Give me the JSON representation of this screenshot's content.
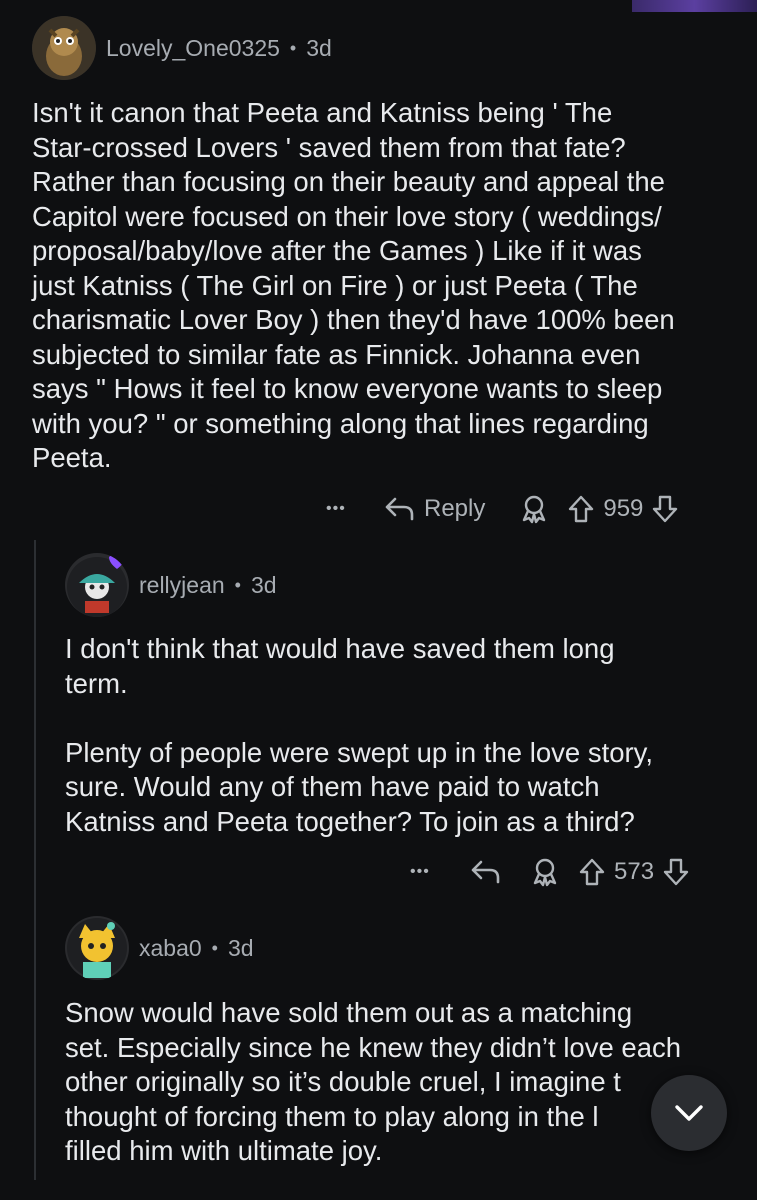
{
  "colors": {
    "background": "#0e0f11",
    "text": "#e8eaed",
    "meta": "#a7acb2",
    "accent_heart": "#8a4fff"
  },
  "comments": [
    {
      "username": "Lovely_One0325",
      "separator": "•",
      "time": "3d",
      "body": "Isn't it canon that Peeta and Katniss being ' The\nStar-crossed Lovers ' saved them from that fate?\nRather than focusing on their beauty and appeal the\nCapitol were focused on their love story ( weddings/\nproposal/baby/love after the Games ) Like if it was\njust Katniss ( The Girl on Fire ) or just Peeta ( The\ncharismatic Lover Boy ) then they'd have 100% been\nsubjected to similar fate as Finnick. Johanna even\nsays \" Hows it feel to know everyone wants to sleep\nwith you? \" or something along that lines regarding\nPeeta.",
      "more_label": "•••",
      "reply_label": "Reply",
      "score": "959"
    },
    {
      "username": "rellyjean",
      "separator": "•",
      "time": "3d",
      "body": "I don't think that would have saved them long\nterm.\n\nPlenty of people were swept up in the love story,\nsure. Would any of them have paid to watch\nKatniss and Peeta together? To join as a third?",
      "more_label": "•••",
      "score": "573"
    },
    {
      "username": "xaba0",
      "separator": "•",
      "time": "3d",
      "body": "Snow would have sold them out as a matching\nset. Especially since he knew they didn’t love each\nother originally so it’s double cruel, I imagine t\nthought of forcing them to play along in the l\nfilled him with ultimate joy."
    }
  ],
  "icons": [
    "more-icon",
    "reply-icon",
    "award-icon",
    "upvote-icon",
    "downvote-icon",
    "chevron-down-icon"
  ]
}
